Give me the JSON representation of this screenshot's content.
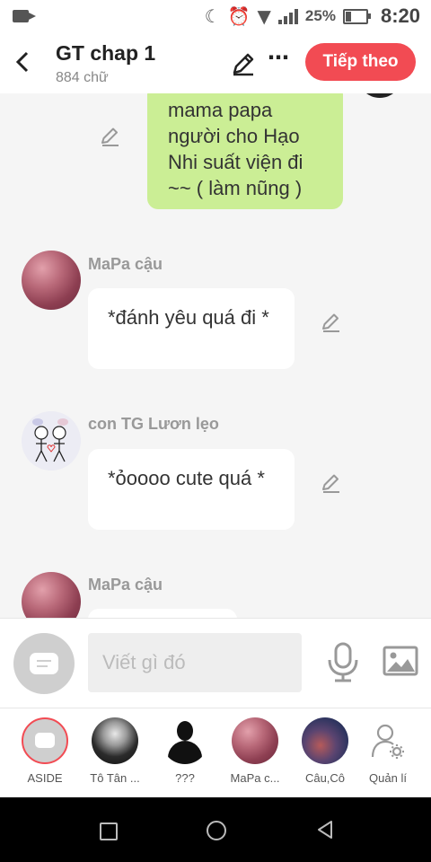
{
  "status_bar": {
    "battery_percent": "25%",
    "time": "8:20",
    "icons": [
      "video-camera-icon",
      "moon-icon",
      "alarm-icon",
      "wifi-icon",
      "signal-icon",
      "battery-icon"
    ]
  },
  "header": {
    "title": "GT chap 1",
    "subtitle": "884 chữ",
    "next_label": "Tiếp theo",
    "more_label": "⋯",
    "back_label": "‹"
  },
  "messages": [
    {
      "side": "right",
      "text": "mama papa người cho Hạo Nhi suất viện đi ~~ ( làm nũng )",
      "color": "#cbee95"
    },
    {
      "side": "left",
      "name": "MaPa cậu",
      "text": "*đánh yêu quá đi *"
    },
    {
      "side": "left",
      "name": "con TG Lươn lẹo",
      "text": "*ỏoooo cute quá *"
    },
    {
      "side": "left",
      "name": "MaPa cậu",
      "text": ""
    }
  ],
  "input": {
    "placeholder": "Viết gì đó"
  },
  "characters": [
    {
      "label": "ASIDE"
    },
    {
      "label": "Tô Tân ..."
    },
    {
      "label": "???"
    },
    {
      "label": "MaPa c..."
    },
    {
      "label": "Câu,Cô"
    },
    {
      "label": "Quản lí"
    }
  ],
  "colors": {
    "accent": "#f24b53",
    "green_bubble": "#cbee95",
    "background": "#f5f5f5"
  }
}
